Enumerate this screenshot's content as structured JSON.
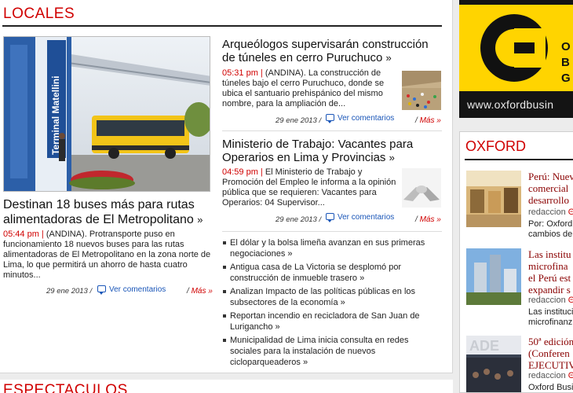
{
  "section": {
    "title": "LOCALES"
  },
  "lead": {
    "photo_sign": "Terminal Matellini",
    "title": "Destinan 18 buses más para rutas alimentadoras de El Metropolitano",
    "title_arrow": "»",
    "time": "05:44 pm |",
    "text": " (ANDINA). Protransporte puso en funcionamiento 18 nuevos buses para las rutas alimentadoras de El Metropolitano en la zona norte de Lima, lo que permitirá un ahorro de hasta cuatro minutos...",
    "date": "29 ene 2013 /",
    "comments": "Ver comentarios",
    "more_sep": "/",
    "more": "Más »"
  },
  "articles": [
    {
      "title": "Arqueólogos supervisarán construcción de túneles en cerro Puruchuco",
      "title_arrow": "»",
      "time": "05:31 pm |",
      "text": " (ANDINA). La construcción de túneles bajo el cerro Puruchuco, donde se ubica el santuario prehispánico del mismo nombre, para la ampliación de...",
      "date": "29 ene 2013 /",
      "comments": "Ver comentarios",
      "more_sep": "/",
      "more": "Más »"
    },
    {
      "title": "Ministerio de Trabajo: Vacantes para Operarios en Lima y Provincias",
      "title_arrow": "»",
      "time": "04:59 pm |",
      "text": " El Ministerio de Trabajo y Promoción del Empleo le informa a la opinión pública que se requieren: Vacantes para Operarios: 04 Supervisor...",
      "date": "29 ene 2013 /",
      "comments": "Ver comentarios",
      "more_sep": "/",
      "more": "Más »"
    }
  ],
  "more_news": [
    "El dólar y la bolsa limeña avanzan en sus primeras negociaciones »",
    "Antigua casa de La Victoria se desplomó por construcción de inmueble trasero »",
    "Analizan Impacto de las políticas públicas en los subsectores de la economía »",
    "Reportan incendio en recicladora de San Juan de Lurigancho »",
    "Municipalidad de Lima inicia consulta en redes sociales para la instalación de nuevos cicloparqueaderos »"
  ],
  "next_section": {
    "title": "ESPECTACULOS"
  },
  "ad": {
    "url": "www.oxfordbusin",
    "letters": [
      "O",
      "B",
      "G"
    ]
  },
  "oxford": {
    "title": "OXFORD",
    "items": [
      {
        "title_lines": [
          "Perú: Nuev",
          "comercial",
          "desarrollo"
        ],
        "source": "redaccion",
        "source_arrow": "Θ",
        "excerpt_lines": [
          "Por: Oxford I",
          "cambios de "
        ]
      },
      {
        "title_lines": [
          "Las institu",
          "microfina",
          "el Perú est",
          "expandir s"
        ],
        "source": "redaccion",
        "source_arrow": "Θ",
        "excerpt_lines": [
          "Las institucio",
          "microfinanz"
        ]
      },
      {
        "title_lines": [
          "50ª edición",
          "(Conferen",
          "EJECUTIV"
        ],
        "source": "redaccion",
        "source_arrow": "Θ",
        "excerpt_lines": [
          "Oxford Busi"
        ]
      }
    ]
  },
  "colors": {
    "accent": "#d00000",
    "link": "#1a56b8",
    "ad_yellow": "#ffd400",
    "oxford_title": "#8a0000"
  }
}
